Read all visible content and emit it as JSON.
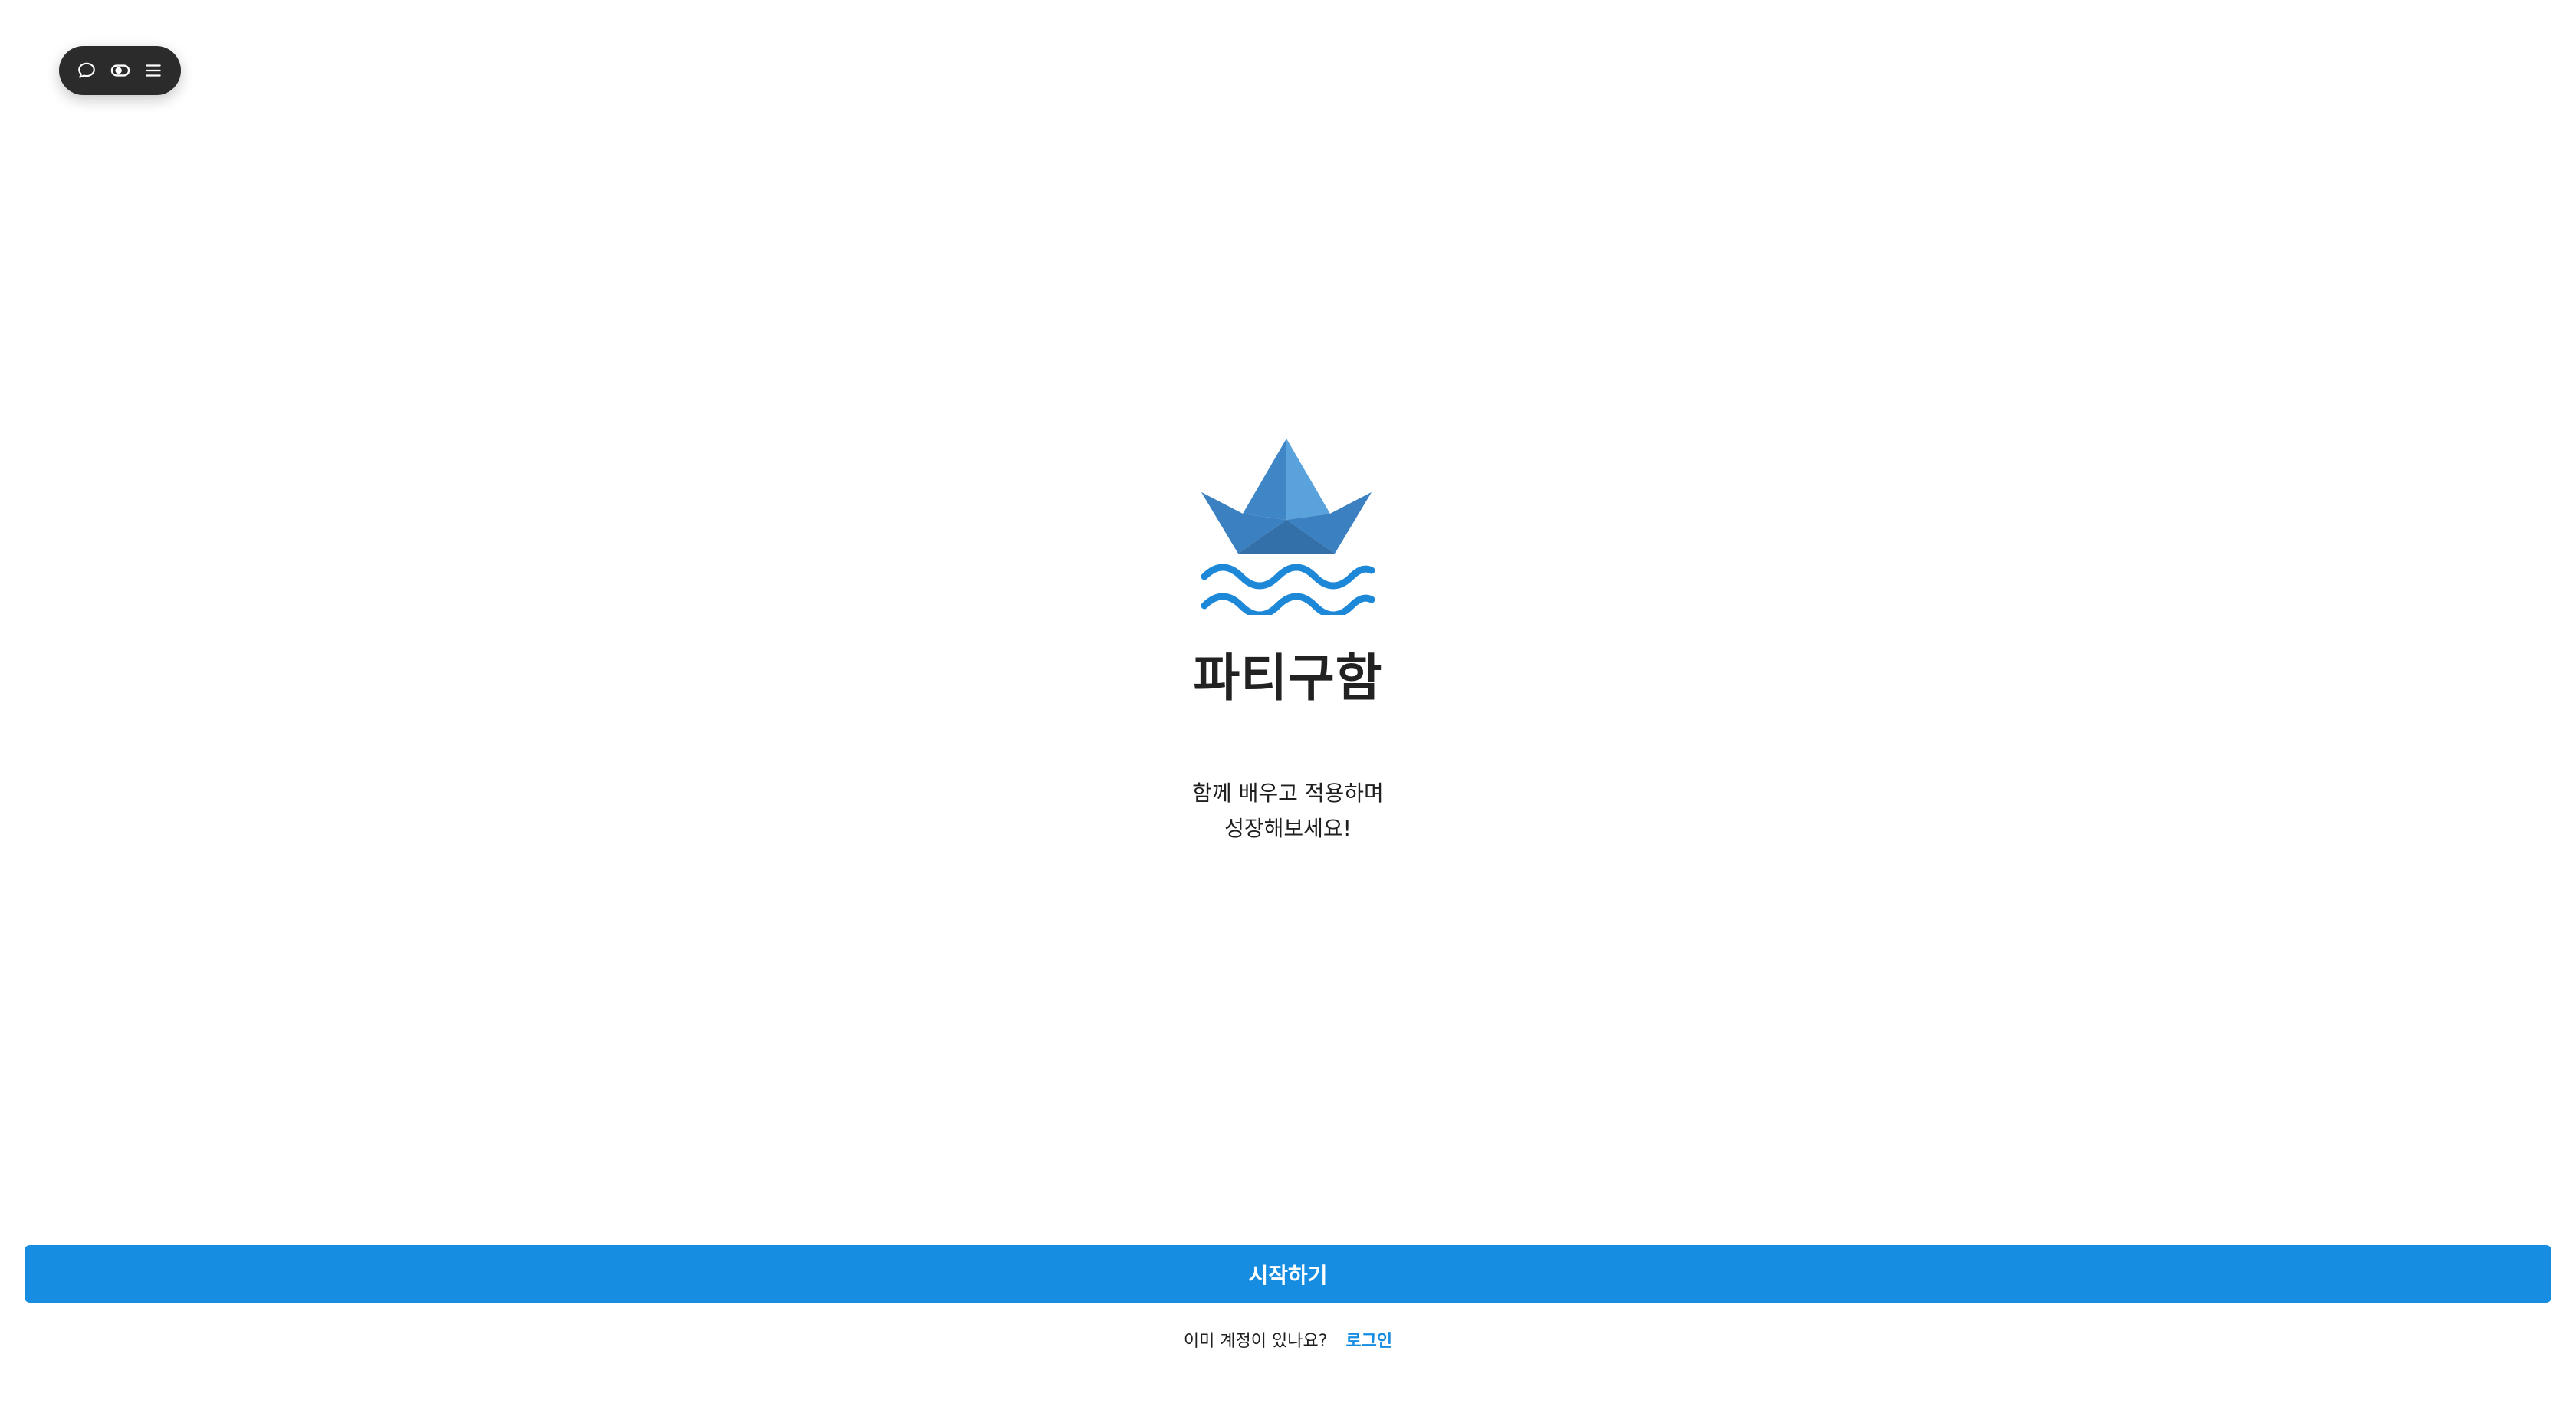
{
  "toolbar": {
    "icons": [
      "chat-bubble-icon",
      "eye-toggle-icon",
      "menu-icon"
    ]
  },
  "hero": {
    "logo_icon": "paper-boat-icon",
    "title": "파티구함",
    "tagline_line1": "함께 배우고 적용하며",
    "tagline_line2": "성장해보세요!"
  },
  "footer": {
    "start_label": "시작하기",
    "account_prompt": "이미 계정이 있나요?",
    "login_label": "로그인"
  },
  "colors": {
    "accent": "#168de1",
    "boat_light": "#4a98d6",
    "boat_dark": "#3b7fbd",
    "waves": "#1e88d8",
    "toolbar_bg": "#2b2b2b"
  }
}
